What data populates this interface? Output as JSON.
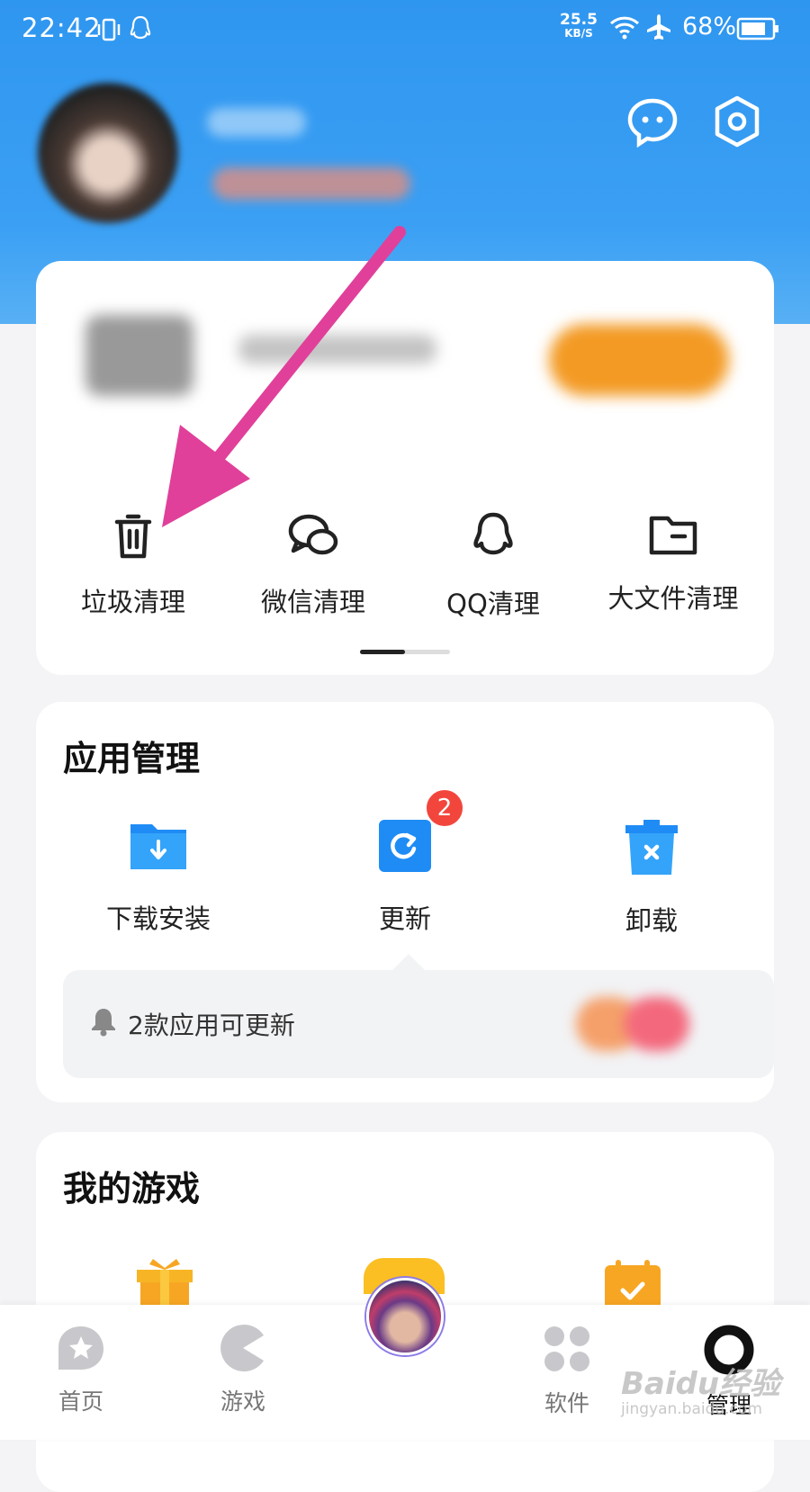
{
  "status_bar": {
    "time": "22:42",
    "net_speed_value": "25.5",
    "net_speed_unit": "KB/S",
    "battery": "68%"
  },
  "cleanup_tools": [
    {
      "label": "垃圾清理",
      "icon": "trash-icon"
    },
    {
      "label": "微信清理",
      "icon": "wechat-icon"
    },
    {
      "label": "QQ清理",
      "icon": "qq-icon"
    },
    {
      "label": "大文件清理",
      "icon": "folder-icon"
    }
  ],
  "app_management": {
    "title": "应用管理",
    "items": [
      {
        "label": "下载安装",
        "icon": "download-folder-icon"
      },
      {
        "label": "更新",
        "icon": "update-icon",
        "badge": "2"
      },
      {
        "label": "卸载",
        "icon": "uninstall-icon"
      }
    ],
    "notice": "2款应用可更新"
  },
  "my_games": {
    "title": "我的游戏"
  },
  "bottom_nav": [
    {
      "label": "首页",
      "icon": "home-star-icon",
      "active": false
    },
    {
      "label": "游戏",
      "icon": "pacman-icon",
      "active": false
    },
    {
      "label": "",
      "icon": "game-avatar-icon",
      "active": false
    },
    {
      "label": "软件",
      "icon": "apps-grid-icon",
      "active": false
    },
    {
      "label": "管理",
      "icon": "manage-ring-icon",
      "active": true
    }
  ],
  "watermark": {
    "brand": "Baidu经验",
    "url": "jingyan.baidu.com"
  },
  "colors": {
    "header": "#2f96f0",
    "accent_orange": "#f39a24",
    "badge_red": "#f2463d",
    "arrow": "#e0409a"
  }
}
